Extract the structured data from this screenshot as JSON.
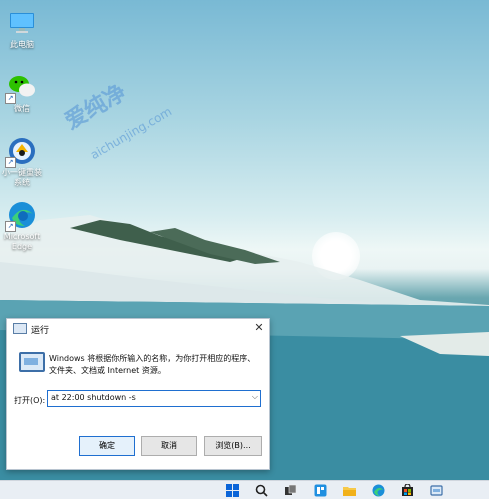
{
  "desktop": {
    "icons": [
      {
        "label": "此电脑"
      },
      {
        "label": "微信"
      },
      {
        "label": "小一键重装\n系统"
      },
      {
        "label": "Microsoft\nEdge"
      }
    ],
    "watermark": {
      "main": "爱纯净",
      "sub": "aichunjing.com"
    }
  },
  "run_dialog": {
    "title": "运行",
    "close_glyph": "✕",
    "description": "Windows 将根据你所输入的名称，为你打开相应的程序、文件夹、文档或 Internet 资源。",
    "open_label": "打开(O):",
    "command_value": "at 22:00 shutdown -s",
    "dropdown_glyph": "⌵",
    "buttons": {
      "ok": "确定",
      "cancel": "取消",
      "browse": "浏览(B)..."
    }
  },
  "taskbar": {
    "icons": [
      "windows-start-icon",
      "search-icon",
      "task-view-icon",
      "widgets-icon",
      "file-explorer-icon",
      "edge-icon",
      "store-icon",
      "run-app-icon"
    ]
  }
}
